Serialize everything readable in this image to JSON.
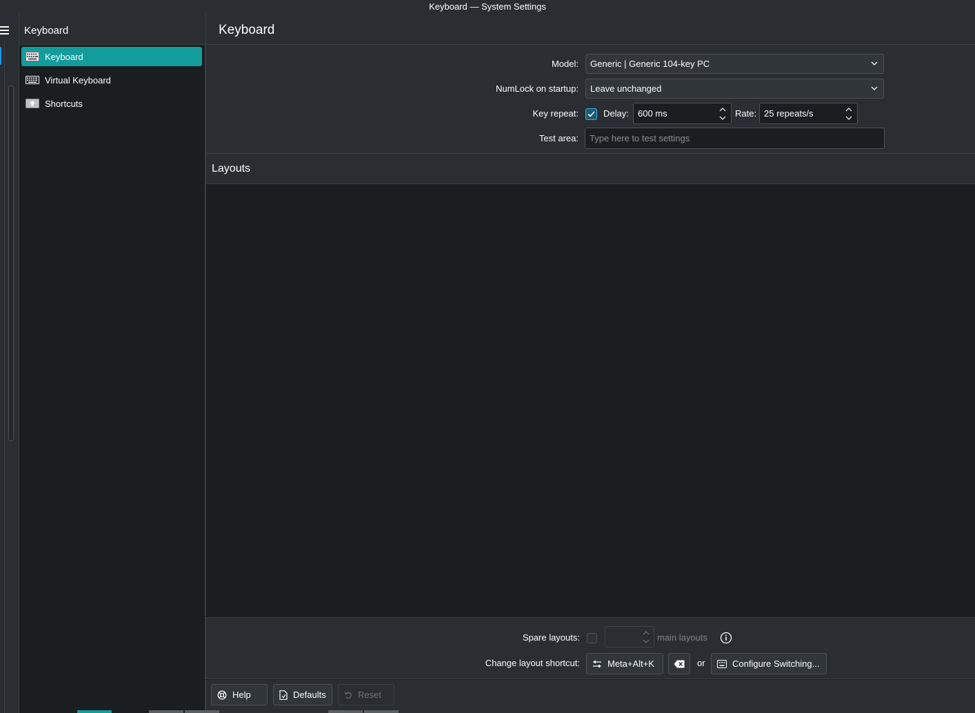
{
  "window": {
    "title": "Keyboard — System Settings"
  },
  "sidebar": {
    "header": "Keyboard",
    "items": [
      {
        "label": "Keyboard",
        "icon": "keyboard-icon",
        "active": true
      },
      {
        "label": "Virtual Keyboard",
        "icon": "virtual-keyboard-icon",
        "active": false
      },
      {
        "label": "Shortcuts",
        "icon": "shortcuts-icon",
        "active": false
      }
    ]
  },
  "page": {
    "title": "Keyboard"
  },
  "form": {
    "model_label": "Model:",
    "model_value": "Generic | Generic 104-key PC",
    "numlock_label": "NumLock on startup:",
    "numlock_value": "Leave unchanged",
    "key_repeat_label": "Key repeat:",
    "key_repeat_checked": true,
    "delay_label": "Delay:",
    "delay_value": "600 ms",
    "rate_label": "Rate:",
    "rate_value": "25 repeats/s",
    "test_label": "Test area:",
    "test_placeholder": "Type here to test settings"
  },
  "layouts": {
    "title": "Layouts",
    "spare_label": "Spare layouts:",
    "spare_checked": false,
    "spare_suffix": "main layouts",
    "change_label": "Change layout shortcut:",
    "shortcut_value": "Meta+Alt+K",
    "or_text": "or",
    "configure_label": "Configure Switching..."
  },
  "footer": {
    "help": "Help",
    "defaults": "Defaults",
    "reset": "Reset"
  },
  "colors": {
    "accent": "#139c9c",
    "highlight": "#3daee9",
    "background": "#1b1e20",
    "panel": "#2a2e32"
  }
}
